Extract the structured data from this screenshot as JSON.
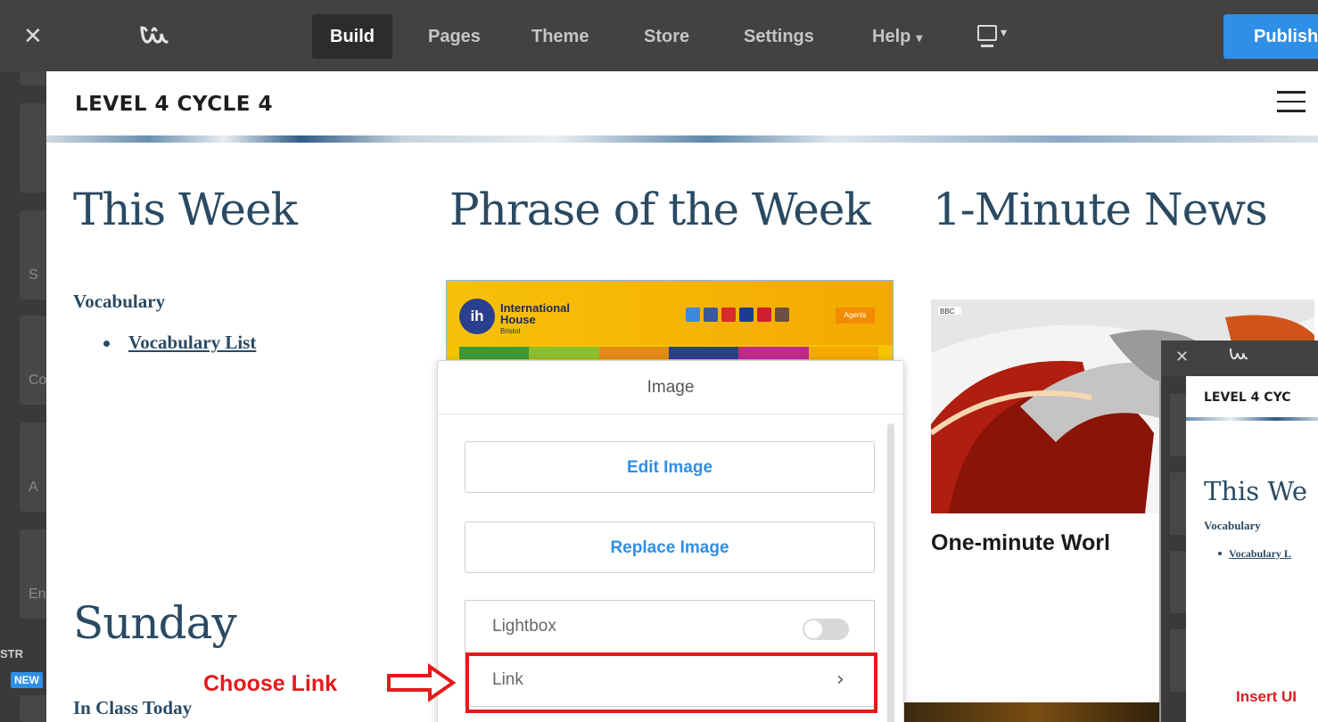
{
  "editor": {
    "logo_glyph": "W",
    "close_glyph": "✕",
    "tabs": [
      {
        "label": "Build"
      },
      {
        "label": "Pages"
      },
      {
        "label": "Theme"
      },
      {
        "label": "Store"
      },
      {
        "label": "Settings"
      },
      {
        "label": "Help"
      }
    ],
    "publish_label": "Publish",
    "sidebar_letters": [
      "S",
      "Co",
      "A",
      "En"
    ],
    "sidebar_section": "STR",
    "new_badge": "NEW"
  },
  "site": {
    "title": "LEVEL 4 CYCLE 4",
    "sections": {
      "this_week": {
        "heading": "This Week",
        "sub": "Vocabulary",
        "link": "Vocabulary List"
      },
      "phrase": {
        "heading": "Phrase of the Week",
        "image": {
          "org_line1": "International",
          "org_line2": "House",
          "org_line3": "Bristol",
          "logo_text": "ih",
          "agents_label": "Agents"
        }
      },
      "news": {
        "heading": "1-Minute News",
        "badge": "BBC",
        "caption": "One-minute Worl"
      },
      "sunday": {
        "heading": "Sunday",
        "sub": "In Class Today"
      }
    }
  },
  "popover": {
    "title": "Image",
    "edit_label": "Edit Image",
    "replace_label": "Replace Image",
    "lightbox_label": "Lightbox",
    "lightbox_on": false,
    "link_label": "Link"
  },
  "annotation": {
    "text": "Choose Link",
    "color": "#e31b1b"
  },
  "inset": {
    "title": "LEVEL 4 CYC",
    "heading": "This We",
    "sub": "Vocabulary",
    "link": "Vocabulary L",
    "insert_text": "Insert UI"
  },
  "colors": {
    "accent": "#2f8fe6",
    "topbar": "#424242",
    "heading": "#2a4a63",
    "annotation": "#e31b1b"
  }
}
